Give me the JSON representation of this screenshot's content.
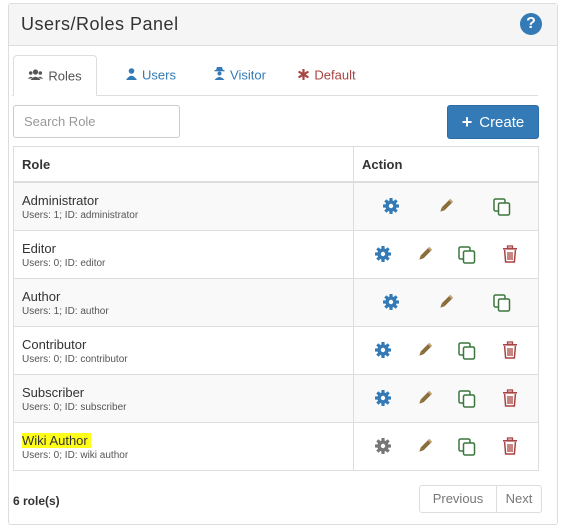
{
  "panel": {
    "title": "Users/Roles Panel",
    "help_symbol": "?"
  },
  "tabs": [
    {
      "label": "Roles",
      "icon": "users-icon",
      "active": true
    },
    {
      "label": "Users",
      "icon": "user-icon",
      "active": false
    },
    {
      "label": "Visitor",
      "icon": "visitor-icon",
      "active": false
    },
    {
      "label": "Default",
      "icon": "asterisk-icon",
      "active": false
    }
  ],
  "search": {
    "placeholder": "Search Role",
    "value": ""
  },
  "create_button": {
    "label": "Create",
    "symbol": "+"
  },
  "table": {
    "headers": {
      "role": "Role",
      "action": "Action"
    },
    "rows": [
      {
        "name": "Administrator",
        "meta": "Users: 1; ID: administrator",
        "deletable": false
      },
      {
        "name": "Editor",
        "meta": "Users: 0; ID: editor",
        "deletable": true
      },
      {
        "name": "Author",
        "meta": "Users: 1; ID: author",
        "deletable": false
      },
      {
        "name": "Contributor",
        "meta": "Users: 0; ID: contributor",
        "deletable": true
      },
      {
        "name": "Subscriber",
        "meta": "Users: 0; ID: subscriber",
        "deletable": true
      },
      {
        "name": "Wiki Author",
        "meta": "Users: 0; ID: wiki author",
        "deletable": true,
        "highlighted": true
      }
    ]
  },
  "footer": {
    "count": "6 role(s)",
    "previous_label": "Previous",
    "next_label": "Next"
  },
  "colors": {
    "primary": "#337ab7",
    "gear": "#337ab7",
    "gear_last": "#777777",
    "pencil": "#8a6d3b",
    "copy": "#3c763d",
    "trash": "#a94442",
    "highlight": "#ffff1a",
    "default_tab": "#a94442"
  }
}
